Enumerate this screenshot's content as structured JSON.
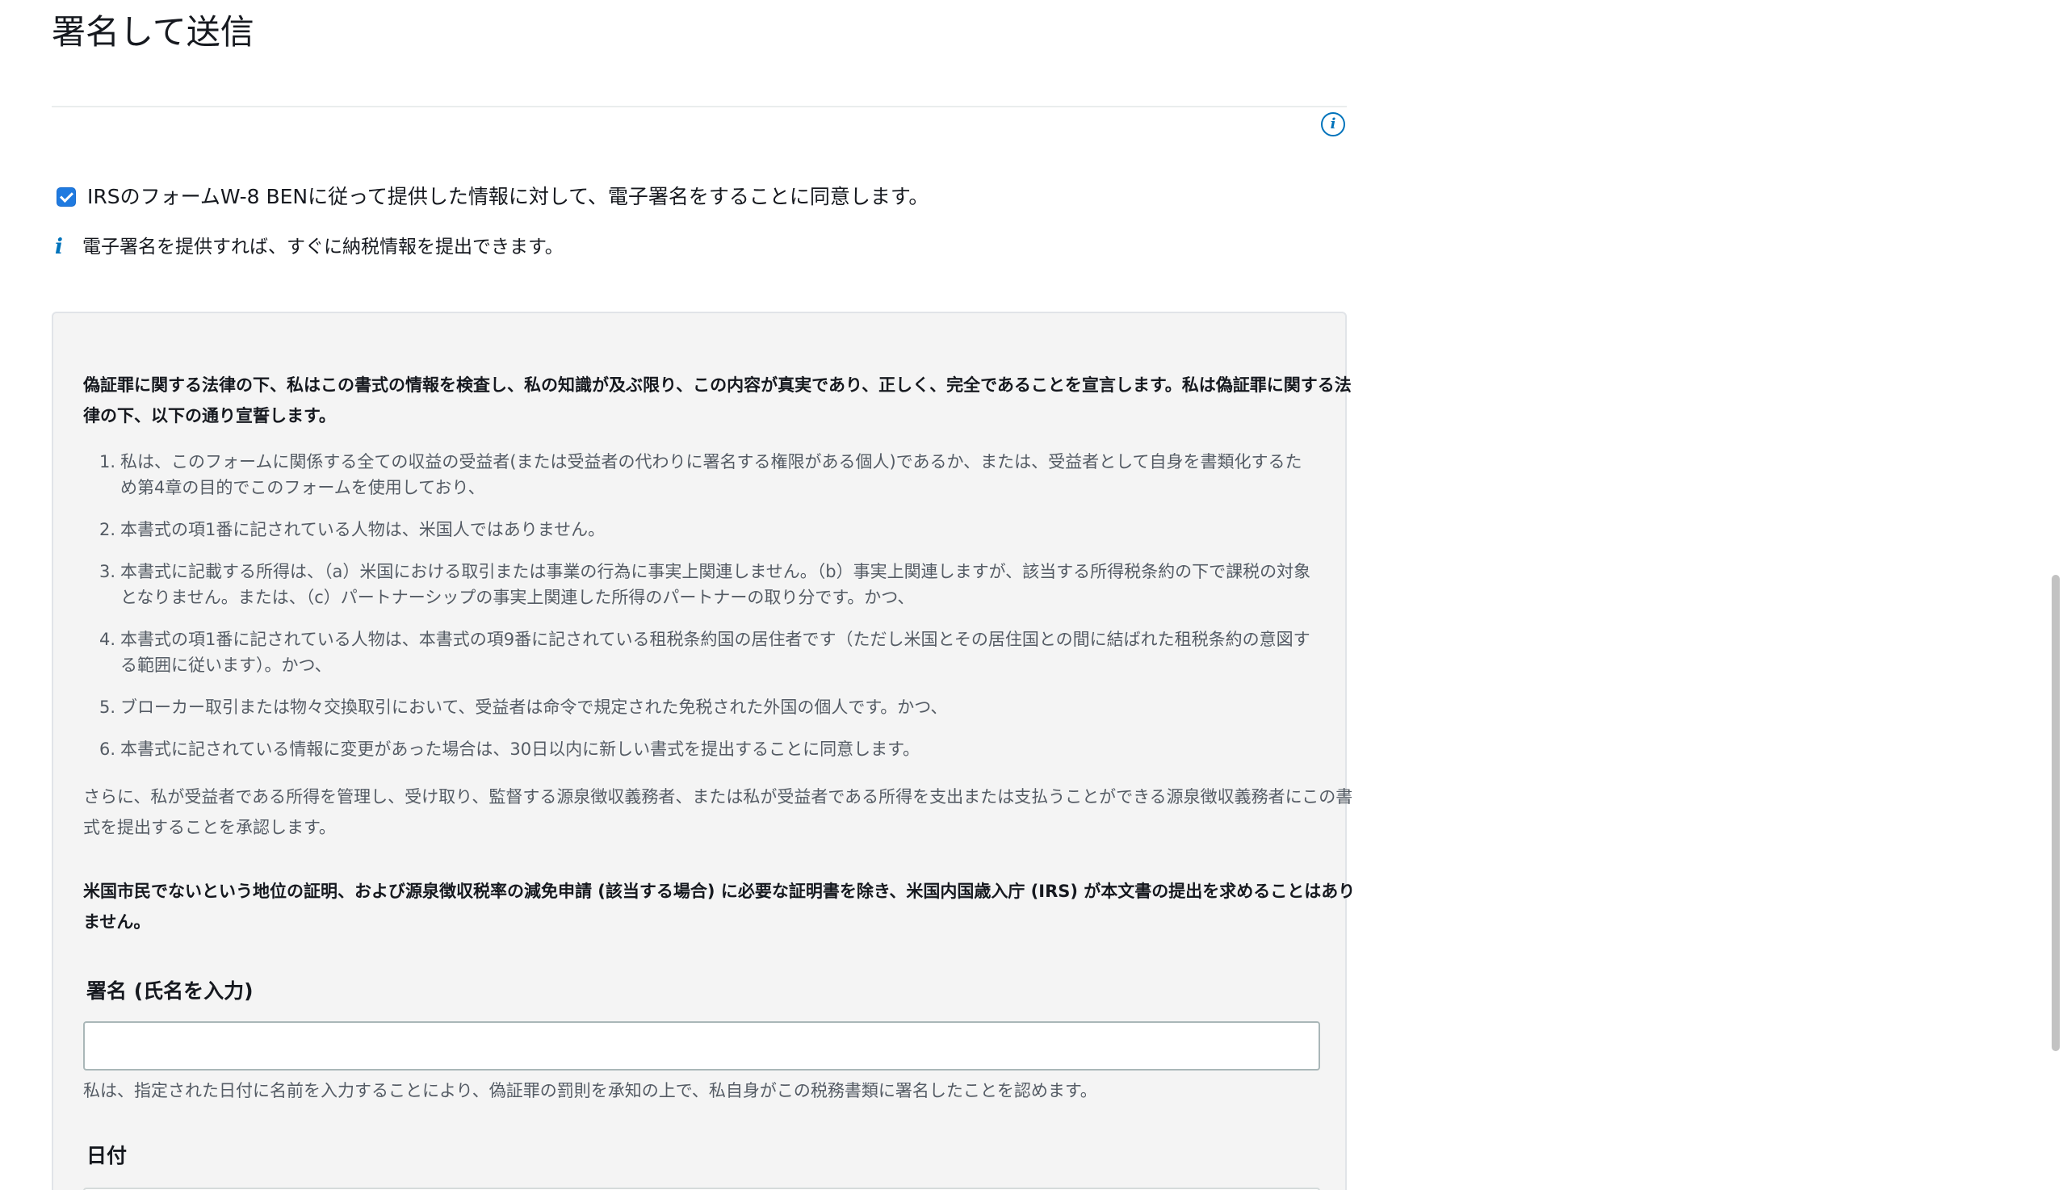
{
  "header": {
    "title": "署名して送信"
  },
  "icons": {
    "info": "info-icon",
    "hint": "info-italic-icon",
    "checkbox": "checkbox-checked-icon"
  },
  "colors": {
    "accent": "#0073bb",
    "checkbox": "#1f7ae0",
    "panel_bg": "#f4f4f4",
    "muted_text": "#545b64"
  },
  "consent": {
    "checked": true,
    "label": "IRSのフォームW-8 BENに従って提供した情報に対して、電子署名をすることに同意します。"
  },
  "hint": {
    "icon_glyph": "i",
    "text": "電子署名を提供すれば、すぐに納税情報を提出できます。"
  },
  "panel": {
    "declaration": "偽証罪に関する法律の下、私はこの書式の情報を検査し、私の知識が及ぶ限り、この内容が真実であり、正しく、完全であることを宣言します。私は偽証罪に関する法律の下、以下の通り宣誓します。",
    "items": [
      {
        "num": "1.",
        "text": "私は、このフォームに関係する全ての収益の受益者(または受益者の代わりに署名する権限がある個人)であるか、または、受益者として自身を書類化するため第4章の目的でこのフォームを使用しており、"
      },
      {
        "num": "2.",
        "text": "本書式の項1番に記されている人物は、米国人ではありません。"
      },
      {
        "num": "3.",
        "text": "本書式に記載する所得は、（a）米国における取引または事業の行為に事実上関連しません。（b）事実上関連しますが、該当する所得税条約の下で課税の対象となりません。または、（c）パートナーシップの事実上関連した所得のパートナーの取り分です。かつ、"
      },
      {
        "num": "4.",
        "text": "本書式の項1番に記されている人物は、本書式の項9番に記されている租税条約国の居住者です（ただし米国とその居住国との間に結ばれた租税条約の意図する範囲に従います）。かつ、"
      },
      {
        "num": "5.",
        "text": "ブローカー取引または物々交換取引において、受益者は命令で規定された免税された外国の個人です。かつ、"
      },
      {
        "num": "6.",
        "text": "本書式に記されている情報に変更があった場合は、30日以内に新しい書式を提出することに同意します。"
      }
    ],
    "further": "さらに、私が受益者である所得を管理し、受け取り、監督する源泉徴収義務者、または私が受益者である所得を支出または支払うことができる源泉徴収義務者にこの書式を提出することを承認します。",
    "irs_note": "米国市民でないという地位の証明、および源泉徴収税率の減免申請 (該当する場合) に必要な証明書を除き、米国内国歳入庁 (IRS) が本文書の提出を求めることはありません。",
    "signature": {
      "label": "署名 (氏名を入力)",
      "value": "",
      "placeholder": "",
      "description": "私は、指定された日付に名前を入力することにより、偽証罪の罰則を承知の上で、私自身がこの税務書類に署名したことを認めます。"
    },
    "date": {
      "label": "日付"
    }
  }
}
